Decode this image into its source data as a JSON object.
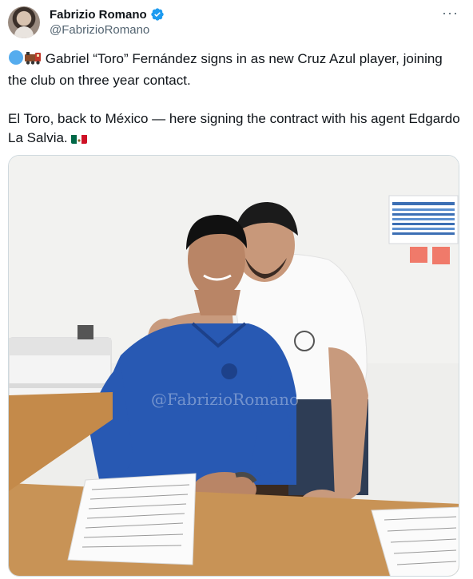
{
  "author": {
    "display_name": "Fabrizio Romano",
    "handle": "@FabrizioRomano"
  },
  "tweet": {
    "line1": "Gabriel “Toro” Fernández signs in as new Cruz Azul player, joining the club on three year contact.",
    "line2": "El Toro, back to México — here signing the contract with his agent Edgardo La Salvia."
  },
  "media": {
    "watermark": "@FabrizioRomano"
  },
  "colors": {
    "verified": "#1d9bf0",
    "text": "#0f1419",
    "secondary": "#536471"
  },
  "icons": [
    "verified-badge-icon",
    "more-options-icon",
    "blue-circle-icon",
    "train-icon",
    "mexico-flag-icon"
  ]
}
